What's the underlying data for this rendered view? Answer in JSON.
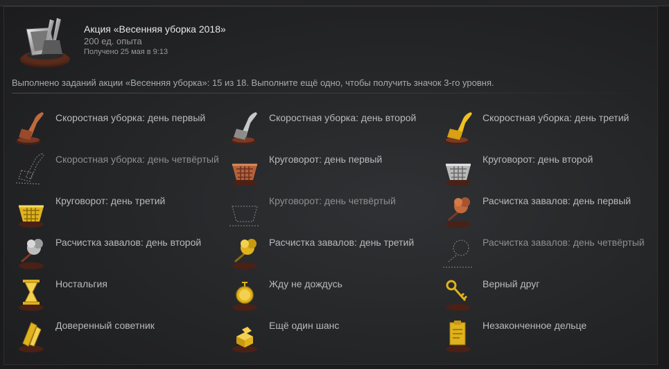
{
  "badge": {
    "title": "Акция «Весенняя уборка 2018»",
    "xp": "200 ед. опыта",
    "unlocked": "Получено 25 мая в 9:13",
    "icon": "dustpan-broom-icon"
  },
  "progress": {
    "text": "Выполнено заданий акции «Весенняя уборка»: 15 из 18. Выполните ещё одно, чтобы получить значок 3-го уровня.",
    "completed": 15,
    "total": 18
  },
  "tasks": [
    {
      "label": "Скоростная уборка: день первый",
      "icon": "bronze-broom-icon",
      "done": true
    },
    {
      "label": "Скоростная уборка: день второй",
      "icon": "silver-broom-icon",
      "done": true
    },
    {
      "label": "Скоростная уборка: день третий",
      "icon": "gold-broom-icon",
      "done": true
    },
    {
      "label": "Скоростная уборка: день четвёртый",
      "icon": "broom-outline-icon",
      "done": false
    },
    {
      "label": "Круговорот: день первый",
      "icon": "bronze-basket-icon",
      "done": true
    },
    {
      "label": "Круговорот: день второй",
      "icon": "silver-basket-icon",
      "done": true
    },
    {
      "label": "Круговорот: день третий",
      "icon": "gold-basket-icon",
      "done": true
    },
    {
      "label": "Круговорот: день четвёртый",
      "icon": "basket-outline-icon",
      "done": false
    },
    {
      "label": "Расчистка завалов: день первый",
      "icon": "bronze-duster-icon",
      "done": true
    },
    {
      "label": "Расчистка завалов: день второй",
      "icon": "silver-duster-icon",
      "done": true
    },
    {
      "label": "Расчистка завалов: день третий",
      "icon": "gold-duster-icon",
      "done": true
    },
    {
      "label": "Расчистка завалов: день четвёртый",
      "icon": "duster-outline-icon",
      "done": false
    },
    {
      "label": "Ностальгия",
      "icon": "hourglass-icon",
      "done": true
    },
    {
      "label": "Жду не дождусь",
      "icon": "pocket-watch-icon",
      "done": true
    },
    {
      "label": "Верный друг",
      "icon": "key-icon",
      "done": true
    },
    {
      "label": "Доверенный советник",
      "icon": "scroll-icon",
      "done": true
    },
    {
      "label": "Ещё один шанс",
      "icon": "dice-icon",
      "done": true
    },
    {
      "label": "Незаконченное дельце",
      "icon": "clipboard-icon",
      "done": true
    }
  ],
  "colors": {
    "bronze": "#b5623a",
    "silver": "#b8b8b8",
    "gold": "#e0b21c",
    "base": "#6a2f1c"
  }
}
